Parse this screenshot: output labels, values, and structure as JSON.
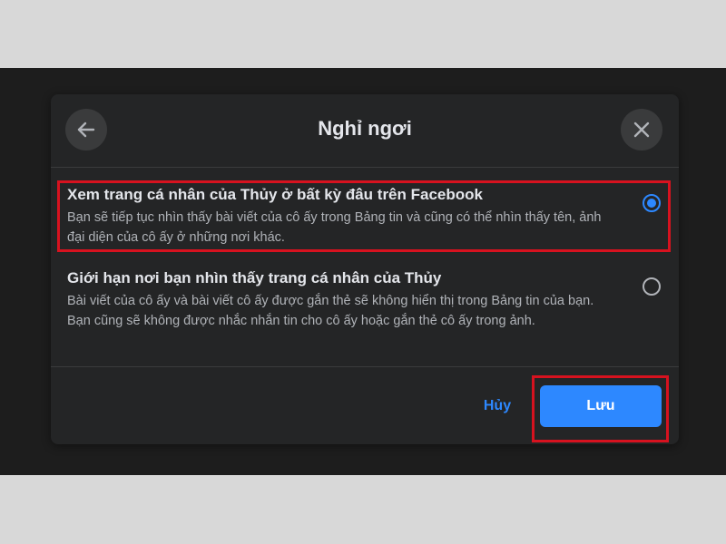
{
  "dialog": {
    "title": "Nghỉ ngơi",
    "back_icon": "arrow-left-icon",
    "close_icon": "close-icon"
  },
  "options": [
    {
      "title": "Xem trang cá nhân của Thủy ở bất kỳ đâu trên Facebook",
      "description": "Bạn sẽ tiếp tục nhìn thấy bài viết của cô ấy trong Bảng tin và cũng có thể nhìn thấy tên, ảnh đại diện của cô ấy ở những nơi khác.",
      "selected": true
    },
    {
      "title": "Giới hạn nơi bạn nhìn thấy trang cá nhân của Thủy",
      "description": "Bài viết của cô ấy và bài viết cô ấy được gắn thẻ sẽ không hiển thị trong Bảng tin của bạn. Bạn cũng sẽ không được nhắc nhắn tin cho cô ấy hoặc gắn thẻ cô ấy trong ảnh.",
      "selected": false
    }
  ],
  "footer": {
    "cancel_label": "Hủy",
    "save_label": "Lưu"
  },
  "colors": {
    "accent": "#2d88ff",
    "dialog_bg": "#242526",
    "highlight": "#d7121f"
  }
}
